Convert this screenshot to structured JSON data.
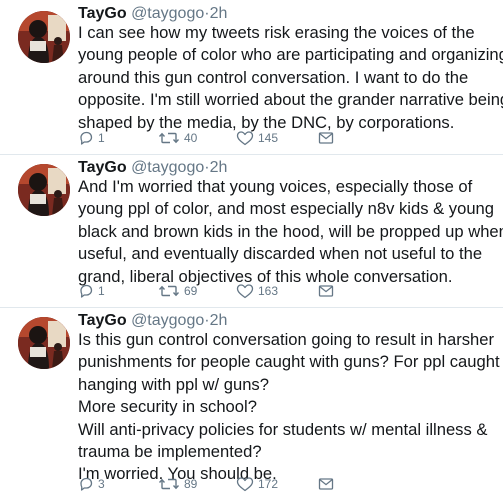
{
  "tweets": [
    {
      "name": "TayGo",
      "handle": "@taygogo",
      "separator": "·",
      "time": "2h",
      "lines": [
        "I can see how my tweets risk erasing the voices of the",
        "young people of color who are participating and organizing",
        "around this gun control conversation. I want to do the",
        "opposite. I'm still worried about the grander narrative being",
        "shaped by the media, by the DNC, by corporations."
      ],
      "replies": "1",
      "retweets": "40",
      "likes": "145"
    },
    {
      "name": "TayGo",
      "handle": "@taygogo",
      "separator": "·",
      "time": "2h",
      "lines": [
        "And I'm worried that young voices, especially those of",
        "young ppl of color, and most especially n8v kids & young",
        "black and brown kids in the hood, will be propped up when",
        "useful, and eventually discarded when not useful to the",
        "grand, liberal objectives of this whole conversation."
      ],
      "replies": "1",
      "retweets": "69",
      "likes": "163"
    },
    {
      "name": "TayGo",
      "handle": "@taygogo",
      "separator": "·",
      "time": "2h",
      "lines": [
        "Is this gun control conversation going to result in harsher",
        "punishments for people caught with guns? For ppl caught",
        "hanging with ppl w/ guns?",
        "More security in school?",
        "Will anti-privacy policies for students w/ mental illness &",
        "trauma be implemented?",
        "I'm worried. You should be."
      ],
      "replies": "3",
      "retweets": "89",
      "likes": "172"
    }
  ],
  "icons": {
    "reply": "reply-icon",
    "retweet": "retweet-icon",
    "like": "heart-icon",
    "dm": "envelope-icon"
  },
  "colors": {
    "text": "#14171a",
    "muted": "#657786",
    "divider": "#e1e8ed"
  }
}
